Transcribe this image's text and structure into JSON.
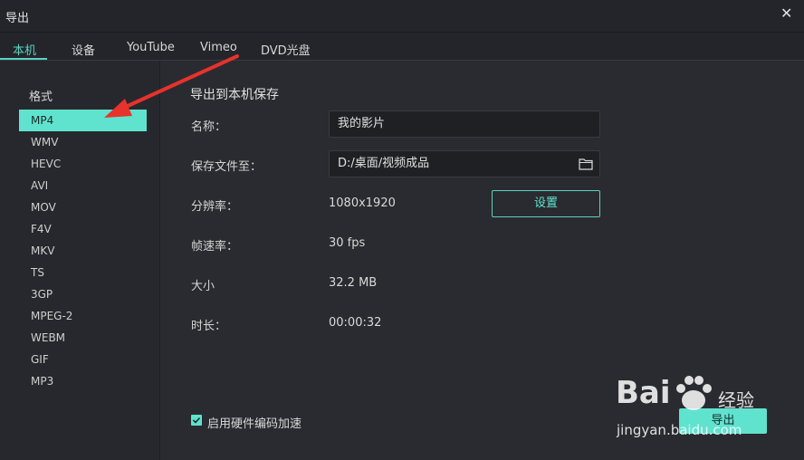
{
  "window": {
    "title": "导出",
    "close_glyph": "✕"
  },
  "tabs": [
    {
      "label": "本机",
      "active": true
    },
    {
      "label": "设备",
      "active": false
    },
    {
      "label": "YouTube",
      "active": false
    },
    {
      "label": "Vimeo",
      "active": false
    },
    {
      "label": "DVD光盘",
      "active": false
    }
  ],
  "sidebar": {
    "heading": "格式",
    "formats": [
      "MP4",
      "WMV",
      "HEVC",
      "AVI",
      "MOV",
      "F4V",
      "MKV",
      "TS",
      "3GP",
      "MPEG-2",
      "WEBM",
      "GIF",
      "MP3"
    ],
    "selected": "MP4"
  },
  "main": {
    "section_title": "导出到本机保存",
    "name_label": "名称：",
    "name_value": "我的影片",
    "save_to_label": "保存文件至：",
    "save_to_value": "D:/桌面/视频成品",
    "resolution_label": "分辨率：",
    "resolution_value": "1080x1920",
    "settings_button": "设置",
    "framerate_label": "帧速率：",
    "framerate_value": "30 fps",
    "size_label": "大小",
    "size_value": "32.2 MB",
    "duration_label": "时长：",
    "duration_value": "00:00:32",
    "hw_accel_label": "启用硬件编码加速",
    "hw_accel_checked": true,
    "export_button": "导出"
  },
  "watermark": {
    "brand": "Bai",
    "brand_suffix": "经验",
    "url": "jingyan.baidu.com"
  },
  "colors": {
    "accent": "#5fe3cf",
    "annotation_arrow": "#e8322c",
    "background": "#2a2b30"
  }
}
